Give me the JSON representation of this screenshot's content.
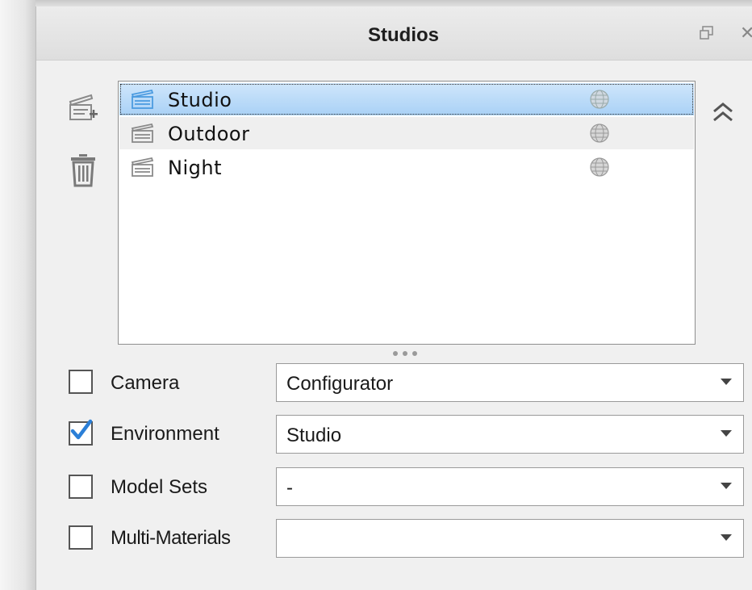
{
  "panel": {
    "title": "Studios",
    "float_icon": "float-window-icon",
    "close_icon": "close-icon",
    "close_glyph": "✕"
  },
  "toolbar": {
    "add_icon": "add-studio-icon",
    "delete_icon": "trash-icon",
    "collapse_icon": "double-chevron-up-icon"
  },
  "studios": {
    "items": [
      {
        "label": "Studio",
        "selected": true,
        "icon": "clapperboard-icon",
        "status_icon": "globe-icon"
      },
      {
        "label": "Outdoor",
        "selected": false,
        "icon": "clapperboard-icon",
        "status_icon": "globe-icon"
      },
      {
        "label": "Night",
        "selected": false,
        "icon": "clapperboard-icon",
        "status_icon": "globe-icon"
      }
    ]
  },
  "options": [
    {
      "label": "Camera",
      "checked": false,
      "value": "Configurator"
    },
    {
      "label": "Environment",
      "checked": true,
      "value": "Studio"
    },
    {
      "label": "Model Sets",
      "checked": false,
      "value": "-"
    },
    {
      "label": "Multi-Materials",
      "checked": false,
      "value": ""
    }
  ],
  "colors": {
    "selection": "#a9d1f6",
    "check_blue": "#2b7fd7",
    "panel_bg": "#f0f0f0"
  }
}
